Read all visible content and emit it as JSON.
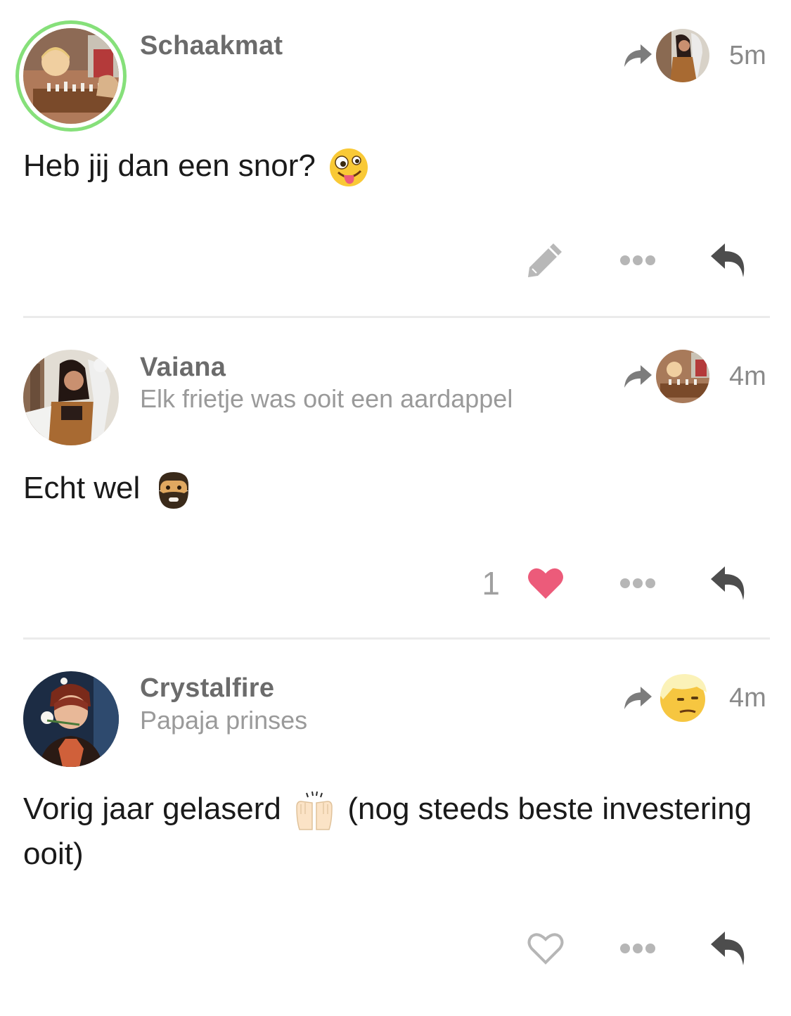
{
  "posts": [
    {
      "username": "Schaakmat",
      "subtitle": "",
      "time": "5m",
      "body": "Heb jij dan een snor?",
      "emoji": "zany-face",
      "likes": "",
      "liked": false,
      "actions": [
        "pencil-icon",
        "more-dots-icon",
        "reply-icon"
      ],
      "online": true
    },
    {
      "username": "Vaiana",
      "subtitle": "Elk frietje was ooit een aardappel",
      "time": "4m",
      "body": "Echt wel",
      "emoji": "bearded-man",
      "likes": "1",
      "liked": true,
      "actions": [
        "heart-icon",
        "more-dots-icon",
        "reply-icon"
      ]
    },
    {
      "username": "Crystalfire",
      "subtitle": "Papaja prinses",
      "time": "4m",
      "body_part1": "Vorig jaar gelaserd",
      "emoji": "raising-hands",
      "body_part2": "(nog steeds beste investering ooit)",
      "likes": "",
      "liked": false,
      "actions": [
        "heart-outline-icon",
        "more-dots-icon",
        "reply-icon"
      ]
    }
  ],
  "colors": {
    "heart_liked": "#ec5b7a",
    "online_ring": "#86e07a",
    "username": "#6b6b6b",
    "subtitle": "#9a9a9a"
  }
}
